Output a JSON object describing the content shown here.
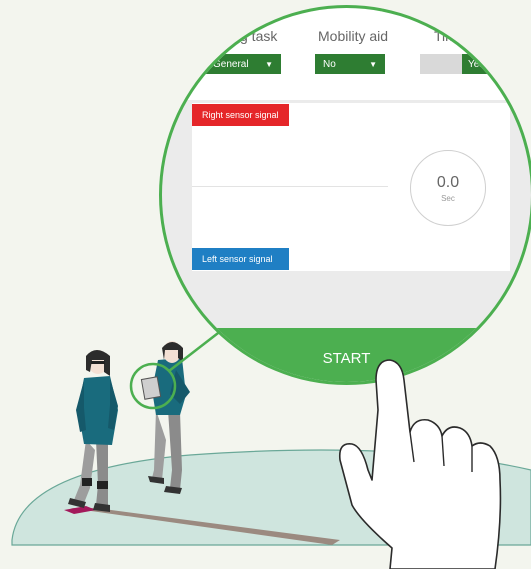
{
  "header": {
    "columns": [
      {
        "label": "g task",
        "select_value": "General",
        "caret": "▼"
      },
      {
        "label": "Mobility aid",
        "select_value": "No",
        "caret": "▼"
      },
      {
        "label": "Timi"
      }
    ],
    "toggle_value": "Yes"
  },
  "signals": {
    "right_label": "Right sensor signal",
    "left_label": "Left sensor signal"
  },
  "timer": {
    "value": "0.0",
    "unit": "Sec"
  },
  "start_label": "START",
  "colors": {
    "accent_green": "#4caf50",
    "dark_green": "#2e7d32",
    "right_red": "#e52629",
    "left_blue": "#1f7fc4"
  },
  "icons": [
    "hand-pointer-icon",
    "caret-down-icon"
  ]
}
